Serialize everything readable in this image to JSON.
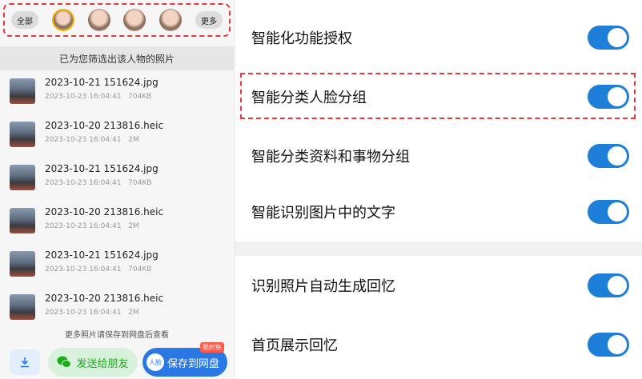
{
  "person_bar": {
    "all_label": "全部",
    "more_label": "更多",
    "avatars": [
      {
        "name": "person-1",
        "selected": true
      },
      {
        "name": "person-2",
        "selected": false
      },
      {
        "name": "person-3",
        "selected": false
      },
      {
        "name": "person-4",
        "selected": false
      }
    ]
  },
  "filter_note": "已为您筛选出该人物的照片",
  "photos": [
    {
      "filename": "2023-10-21 151624.jpg",
      "meta": "2023-10-23 16:04:41   704KB"
    },
    {
      "filename": "2023-10-20 213816.heic",
      "meta": "2023-10-23 16:04:41   2M"
    },
    {
      "filename": "2023-10-21 151624.jpg",
      "meta": "2023-10-23 16:04:41   704KB"
    },
    {
      "filename": "2023-10-20 213816.heic",
      "meta": "2023-10-23 16:04:41   2M"
    },
    {
      "filename": "2023-10-21 151624.jpg",
      "meta": "2023-10-23 16:04:41   704KB"
    },
    {
      "filename": "2023-10-20 213816.heic",
      "meta": "2023-10-23 16:04:41   2M"
    }
  ],
  "more_note": "更多照片请保存到网盘后查看",
  "bottom_bar": {
    "download_icon": "download-icon",
    "send_label": "发送给朋友",
    "send_icon": "wechat-icon",
    "save_label": "保存到网盘",
    "face_chip": "人脸",
    "limited_badge": "限时免"
  },
  "settings": [
    {
      "label": "智能化功能授权",
      "enabled": true
    },
    {
      "label": "智能分类人脸分组",
      "enabled": true
    },
    {
      "label": "智能分类资料和事物分组",
      "enabled": true
    },
    {
      "label": "智能识别图片中的文字",
      "enabled": true
    },
    {
      "label": "识别照片自动生成回忆",
      "enabled": true
    },
    {
      "label": "首页展示回忆",
      "enabled": true
    }
  ],
  "colors": {
    "accent_blue": "#2a78e4",
    "toggle_on": "#1e7fd8",
    "wechat_green": "#1aad19",
    "highlight_red": "#e03a3a"
  }
}
